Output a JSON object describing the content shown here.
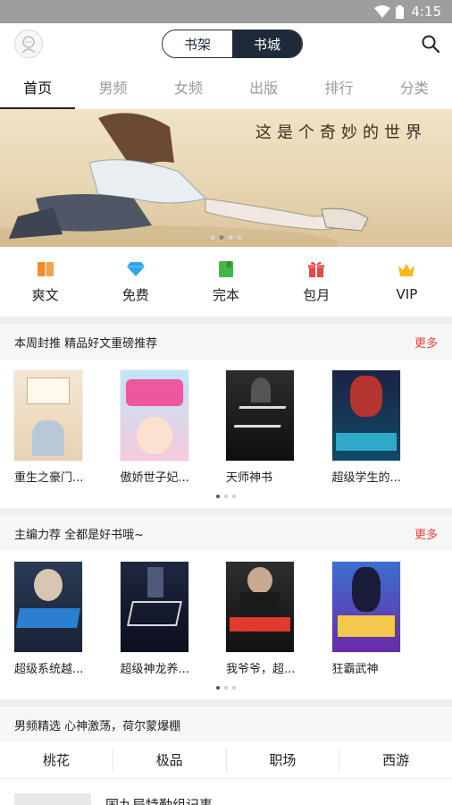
{
  "status": {
    "time": "4:15"
  },
  "header": {
    "segment": {
      "shelf": "书架",
      "store": "书城"
    }
  },
  "tabs": [
    "首页",
    "男频",
    "女频",
    "出版",
    "排行",
    "分类"
  ],
  "banner": {
    "text": "这是个奇妙的世界"
  },
  "quick": [
    {
      "label": "爽文",
      "icon": "book-icon",
      "color": "#f28a2e"
    },
    {
      "label": "免费",
      "icon": "diamond-icon",
      "color": "#2ea6e8"
    },
    {
      "label": "完本",
      "icon": "bookmark-book-icon",
      "color": "#43b649"
    },
    {
      "label": "包月",
      "icon": "gift-icon",
      "color": "#e54848"
    },
    {
      "label": "VIP",
      "icon": "crown-icon",
      "color": "#f5b91e"
    }
  ],
  "section1": {
    "title": "本周封推  精品好文重磅推荐",
    "more": "更多",
    "books": [
      "重生之豪门...",
      "傲娇世子妃...",
      "天师神书",
      "超级学生的..."
    ]
  },
  "section2": {
    "title": "主编力荐  全都是好书哦~",
    "more": "更多",
    "books": [
      "超级系统越...",
      "超级神龙养...",
      "我爷爷，超...",
      "狂霸武神"
    ]
  },
  "section3": {
    "title": "男频精选  心神激荡，荷尔蒙爆棚",
    "genres": [
      "桃花",
      "极品",
      "职场",
      "西游"
    ],
    "item": "国九局特勤组记事"
  }
}
